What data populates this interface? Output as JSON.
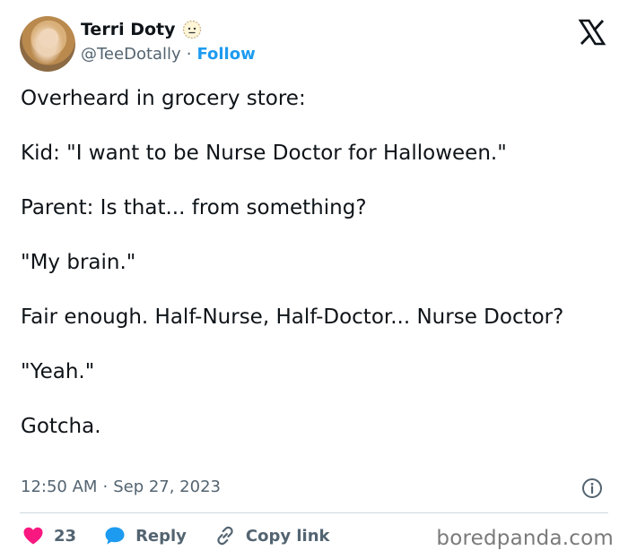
{
  "author": {
    "name": "Terri Doty",
    "handle": "@TeeDotally",
    "separator": "·",
    "follow_label": "Follow"
  },
  "tweet": {
    "paragraphs": [
      "Overheard in grocery store:",
      "Kid: \"I want to be Nurse Doctor for Halloween.\"",
      "Parent: Is that... from something?",
      "\"My brain.\"",
      "Fair enough. Half-Nurse, Half-Doctor... Nurse Doctor?",
      "\"Yeah.\"",
      "Gotcha."
    ],
    "time": "12:50 AM",
    "meta_separator": "·",
    "date": "Sep 27, 2023"
  },
  "actions": {
    "like_count": "23",
    "reply_label": "Reply",
    "copy_link_label": "Copy link"
  },
  "watermark": "boredpanda.com",
  "colors": {
    "accent": "#1d9bf0",
    "like": "#f91880",
    "text": "#0f1419",
    "muted": "#536471"
  },
  "icons": {
    "badge": "neutral-face-emoji-icon",
    "platform": "x-logo-icon",
    "info": "info-icon",
    "like": "heart-icon",
    "reply": "speech-bubble-icon",
    "copy": "link-icon"
  }
}
